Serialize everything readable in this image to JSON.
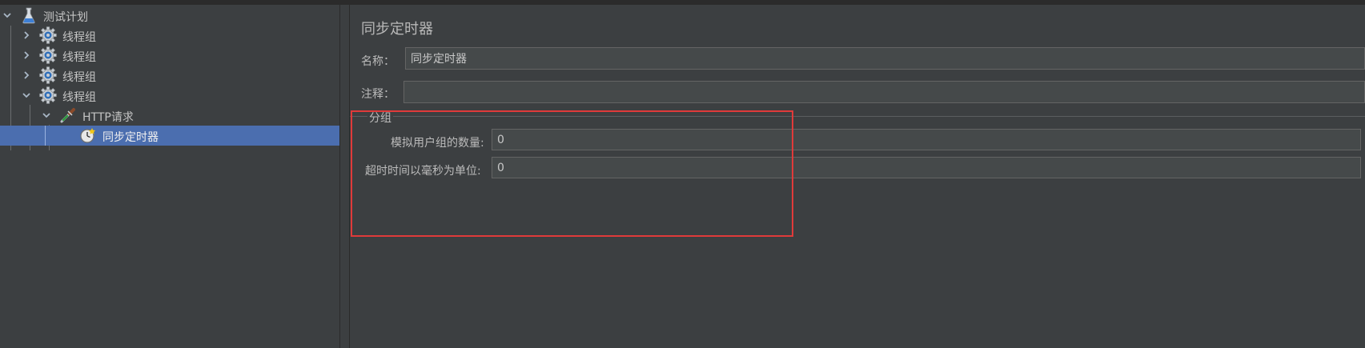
{
  "tree": {
    "items": [
      {
        "label": "测试计划",
        "icon": "flask-icon",
        "expanded": true
      },
      {
        "label": "线程组",
        "icon": "gear-icon",
        "expanded": false
      },
      {
        "label": "线程组",
        "icon": "gear-icon",
        "expanded": false
      },
      {
        "label": "线程组",
        "icon": "gear-icon",
        "expanded": false
      },
      {
        "label": "线程组",
        "icon": "gear-icon",
        "expanded": true
      },
      {
        "label": "HTTP请求",
        "icon": "pipette-icon",
        "expanded": true
      },
      {
        "label": "同步定时器",
        "icon": "timer-icon",
        "selected": true
      }
    ]
  },
  "panel": {
    "title": "同步定时器",
    "name_label": "名称：",
    "name_value": "同步定时器",
    "comment_label": "注释：",
    "comment_value": "",
    "group": {
      "title": "分组",
      "users_label": "模拟用户组的数量:",
      "users_value": "0",
      "timeout_label": "超时时间以毫秒为单位:",
      "timeout_value": "0"
    }
  },
  "colors": {
    "background": "#3c3f41",
    "selection": "#4b6eaf",
    "input_bg": "#45494a",
    "highlight_box": "#e03a3a"
  }
}
